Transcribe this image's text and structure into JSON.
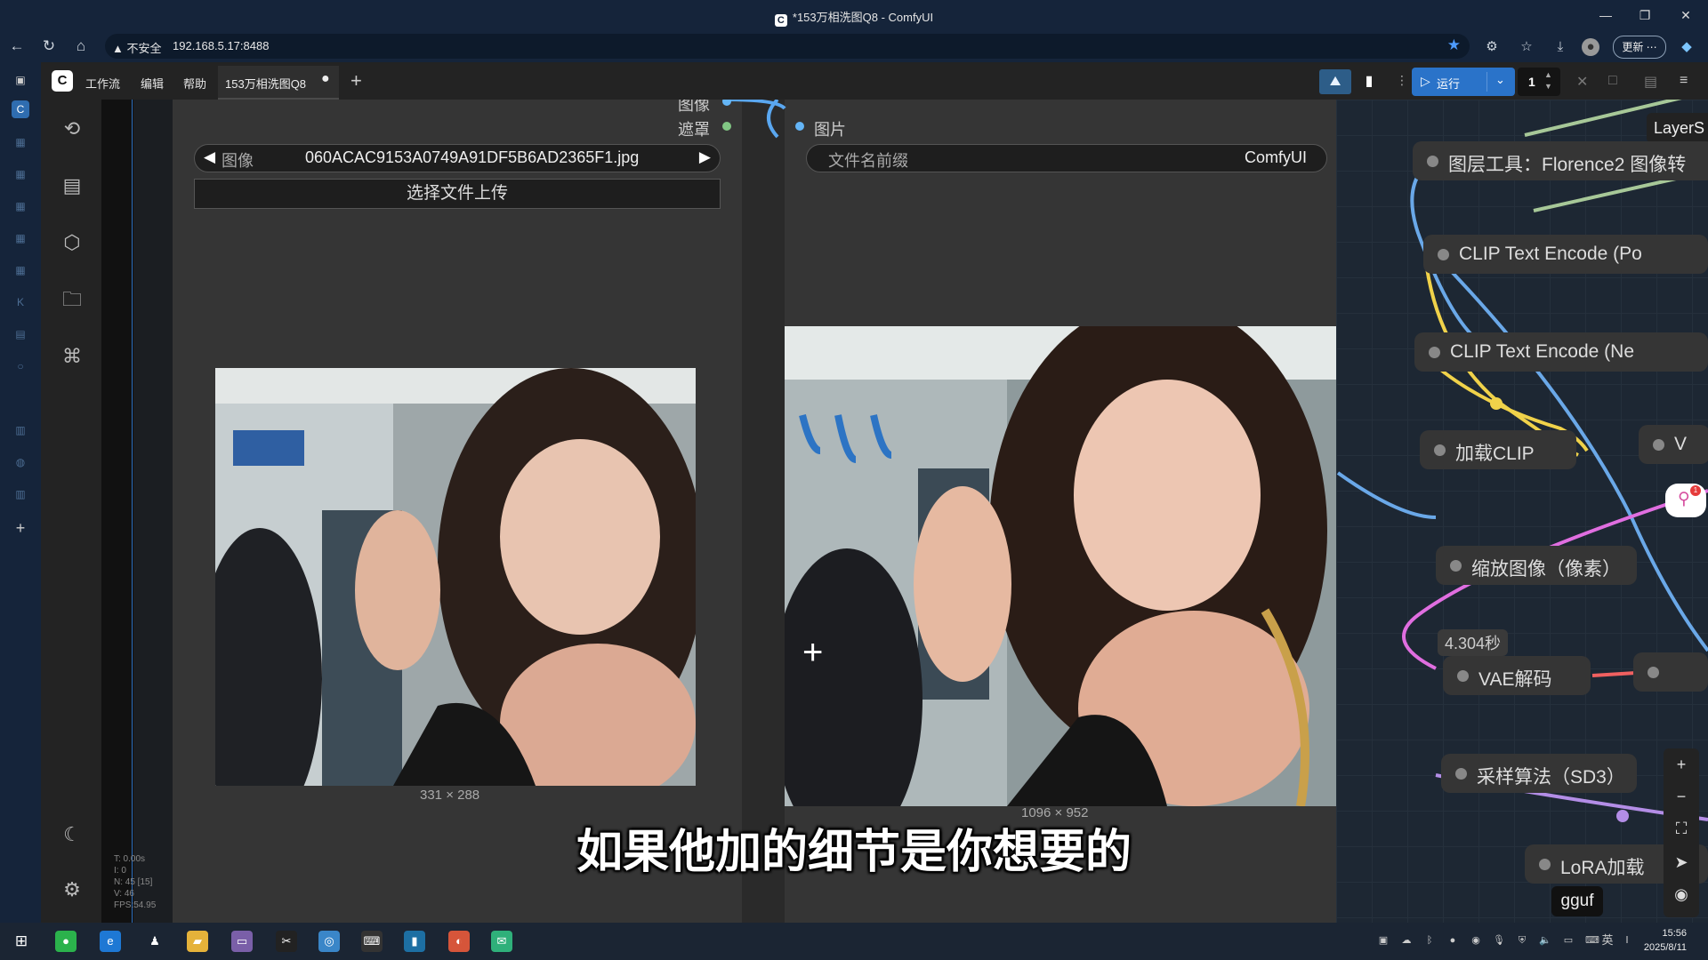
{
  "window": {
    "title": "*153万相洗图Q8 - ComfyUI"
  },
  "browser": {
    "security_label": "不安全",
    "url": "192.168.5.17:8488",
    "update_label": "更新"
  },
  "comfy": {
    "menu": [
      "工作流",
      "编辑",
      "帮助"
    ],
    "tab_label": "153万相洗图Q8",
    "run_label": "运行",
    "batch_count": "1"
  },
  "load_image_node": {
    "output_image_label": "图像",
    "output_mask_label": "遮罩",
    "image_widget_name": "图像",
    "image_widget_value": "060ACAC9153A0749A91DF5B6AD2365F1.jpg",
    "upload_label": "选择文件上传",
    "preview_dims": "331 × 288"
  },
  "save_image_node": {
    "input_label": "图片",
    "prefix_name": "文件名前缀",
    "prefix_value": "ComfyUI",
    "preview_dims": "1096 × 952"
  },
  "graph_nodes": {
    "layer_chip": "LayerS",
    "florence": "图层工具：Florence2 图像转",
    "clip_pos": "CLIP Text Encode (Po",
    "clip_neg": "CLIP Text Encode (Ne",
    "load_clip": "加载CLIP",
    "v_node": "V",
    "scale_image": "缩放图像（像素）",
    "time_badge": "4.304秒",
    "vae_decode": "VAE解码",
    "sampler": "采样算法（SD3）",
    "lora": "LoRA加载",
    "gguf": "gguf",
    "pin_badge": "1"
  },
  "stats": [
    "T: 0.00s",
    "I: 0",
    "N: 45 [15]",
    "V: 46",
    "FPS:54.95"
  ],
  "subtitle": "如果他加的细节是你想要的",
  "clock": {
    "time": "15:56",
    "date": "2025/8/11"
  },
  "tray_lang": "英"
}
